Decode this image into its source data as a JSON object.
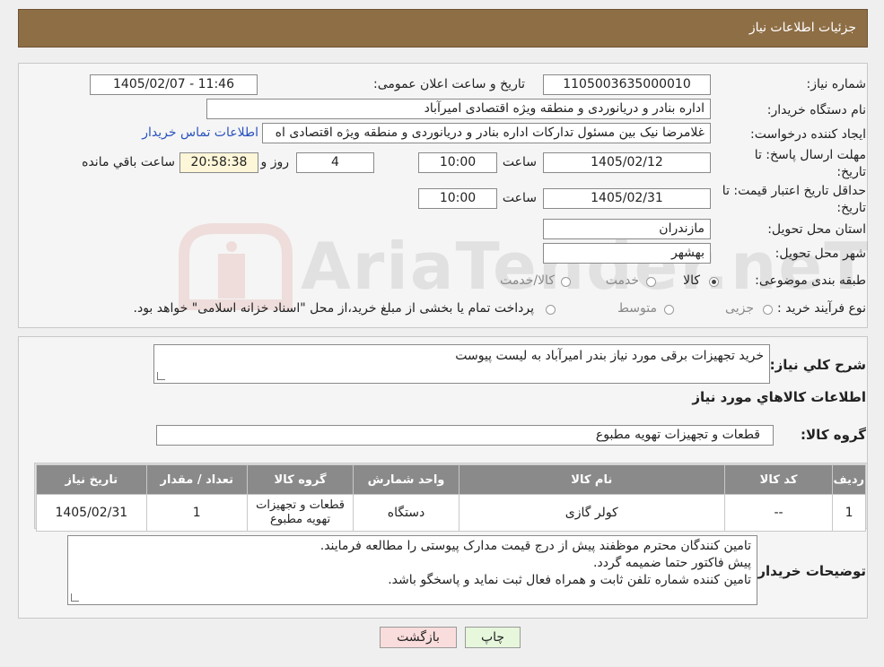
{
  "header": {
    "title": "جزئیات اطلاعات نیاز"
  },
  "form": {
    "need_number": {
      "label": "شماره نیاز:",
      "value": "1105003635000010"
    },
    "announce_datetime": {
      "label": "تاریخ و ساعت اعلان عمومی:",
      "value": "1405/02/07 - 11:46"
    },
    "buyer_org": {
      "label": "نام دستگاه خریدار:",
      "value": "اداره بنادر و دریانوردی و منطقه ویژه اقتصادی امیرآباد"
    },
    "requester": {
      "label": "ایجاد کننده درخواست:",
      "value": "غلامرضا نیک بین مسئول تدارکات اداره بنادر و دریانوردی و منطقه ویژه اقتصادی اه",
      "contact_link": "اطلاعات تماس خریدار"
    },
    "response_deadline": {
      "label_line1": "مهلت ارسال پاسخ: تا",
      "label_line2": "تاریخ:",
      "date": "1405/02/12",
      "time_label": "ساعت",
      "time": "10:00",
      "days": "4",
      "days_label": "روز و",
      "remaining": "20:58:38",
      "remaining_label": "ساعت باقي مانده"
    },
    "price_validity": {
      "label_line1": "حداقل تاریخ اعتبار قیمت: تا",
      "label_line2": "تاریخ:",
      "date": "1405/02/31",
      "time_label": "ساعت",
      "time": "10:00"
    },
    "province": {
      "label": "استان محل تحویل:",
      "value": "مازندران"
    },
    "city": {
      "label": "شهر محل تحویل:",
      "value": "بهشهر"
    },
    "category": {
      "label": "طبقه بندی موضوعی:",
      "options": [
        "کالا",
        "خدمت",
        "کالا/خدمت"
      ],
      "selected": "کالا"
    },
    "purchase_type": {
      "label": "نوع فرآیند خرید :",
      "options": [
        "جزیی",
        "متوسط"
      ],
      "note": "پرداخت تمام یا بخشی از مبلغ خرید،از محل \"اسناد خزانه اسلامی\" خواهد بود."
    }
  },
  "summary": {
    "label": "شرح کلي نياز:",
    "value": "خرید تجهیزات برقی مورد نیاز بندر امیرآباد به لیست پیوست"
  },
  "goods_info_title": "اطلاعات کالاهاي مورد نياز",
  "goods_group": {
    "label": "گروه کالا:",
    "value": "قطعات و تجهیزات تهویه مطبوع"
  },
  "table": {
    "headers": [
      "رديف",
      "کد کالا",
      "نام کالا",
      "واحد شمارش",
      "گروه کالا",
      "تعداد / مقدار",
      "تاریخ نیاز"
    ],
    "rows": [
      [
        "1",
        "--",
        "کولر گازی",
        "دستگاه",
        "قطعات و تجهیزات تهویه مطبوع",
        "1",
        "1405/02/31"
      ]
    ]
  },
  "buyer_notes": {
    "label": "توضیحات خریدار:",
    "lines": [
      "تامین کنندگان محترم موظفند پیش از درج قیمت مدارک پیوستی را مطالعه فرمایند.",
      "پیش فاکتور حتما ضمیمه گردد.",
      " تامین کننده شماره تلفن ثابت و همراه فعال ثبت نماید و پاسخگو باشد."
    ]
  },
  "buttons": {
    "print": "چاپ",
    "back": "بازگشت"
  },
  "watermark": {
    "text": "AriaTender.neT"
  },
  "colors": {
    "header": "#8e6e45",
    "link": "#2a52be",
    "print_btn": "#e6f7dc",
    "back_btn": "#f9dcdc"
  }
}
